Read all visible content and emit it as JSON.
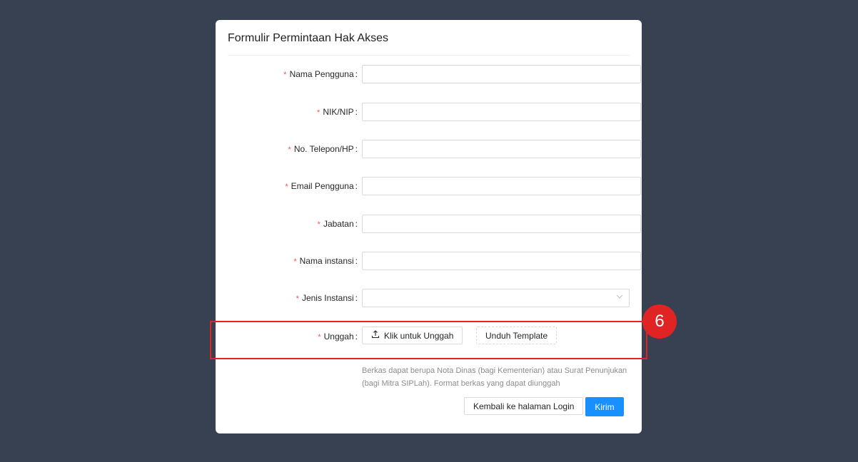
{
  "modal": {
    "title": "Formulir Permintaan Hak Akses"
  },
  "form": {
    "required_mark": "*",
    "colon": ":",
    "fields": {
      "nama_pengguna": {
        "label": "Nama Pengguna",
        "value": "",
        "placeholder": ""
      },
      "nik_nip": {
        "label": "NIK/NIP",
        "value": "",
        "placeholder": ""
      },
      "telepon": {
        "label": "No. Telepon/HP",
        "value": "",
        "placeholder": ""
      },
      "email": {
        "label": "Email Pengguna",
        "value": "",
        "placeholder": ""
      },
      "jabatan": {
        "label": "Jabatan",
        "value": "",
        "placeholder": ""
      },
      "nama_instansi": {
        "label": "Nama instansi",
        "value": "",
        "placeholder": ""
      },
      "jenis_instansi": {
        "label": "Jenis Instansi",
        "selected": ""
      },
      "unggah": {
        "label": "Unggah"
      }
    },
    "upload_button": "Klik untuk Unggah",
    "template_button": "Unduh Template",
    "helper_text": "Berkas dapat berupa Nota Dinas (bagi Kementerian) atau Surat Penunjukan (bagi Mitra SIPLah). Format berkas yang dapat diunggah",
    "back_button": "Kembali ke halaman Login",
    "submit_button": "Kirim"
  },
  "annotation": {
    "step_number": "6",
    "color": "#e02424"
  },
  "icons": {
    "upload": "upload-icon",
    "dropdown": "chevron-down-icon"
  },
  "colors": {
    "background": "#374151",
    "primary": "#1890ff",
    "required": "#ff4d4f"
  }
}
